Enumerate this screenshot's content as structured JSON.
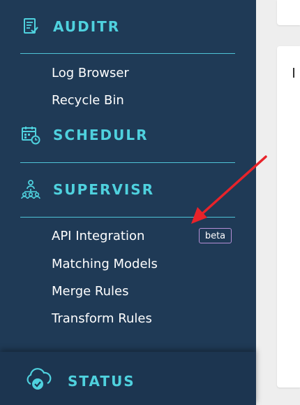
{
  "sidebar": {
    "auditr": {
      "label": "AUDITR",
      "icon": "audit-icon",
      "items": [
        {
          "label": "Log Browser"
        },
        {
          "label": "Recycle Bin"
        }
      ]
    },
    "schedulr": {
      "label": "SCHEDULR",
      "icon": "calendar-clock-icon"
    },
    "supervisr": {
      "label": "SUPERVISR",
      "icon": "hierarchy-icon",
      "items": [
        {
          "label": "API Integration",
          "badge": "beta"
        },
        {
          "label": "Matching Models"
        },
        {
          "label": "Merge Rules"
        },
        {
          "label": "Transform Rules"
        }
      ]
    },
    "status": {
      "label": "STATUS",
      "icon": "cloud-check-icon"
    }
  },
  "colors": {
    "sidebar_bg": "#1f3a56",
    "accent": "#4fd1de",
    "badge_border": "#b58fd6",
    "annotation_arrow": "#e8232a"
  }
}
